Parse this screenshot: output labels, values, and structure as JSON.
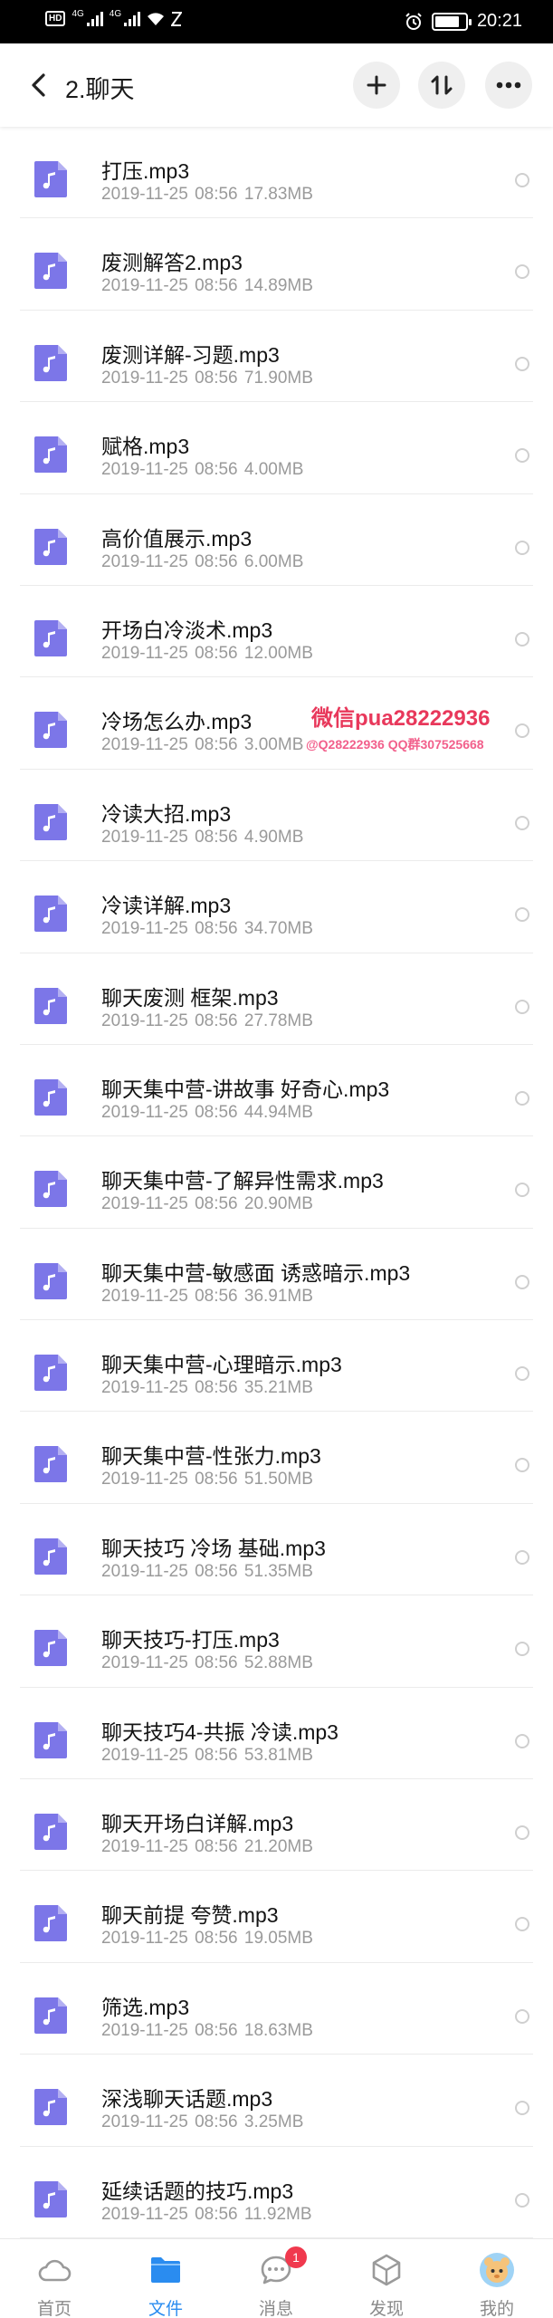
{
  "status_bar": {
    "network_badge": "HD",
    "signal1_label": "4G",
    "signal2_label": "4G",
    "time": "20:21"
  },
  "header": {
    "title": "2.聊天"
  },
  "files": [
    {
      "name": "打压.mp3",
      "date": "2019-11-25",
      "time": "08:56",
      "size": "17.83MB"
    },
    {
      "name": "废测解答2.mp3",
      "date": "2019-11-25",
      "time": "08:56",
      "size": "14.89MB"
    },
    {
      "name": "废测详解-习题.mp3",
      "date": "2019-11-25",
      "time": "08:56",
      "size": "71.90MB"
    },
    {
      "name": "赋格.mp3",
      "date": "2019-11-25",
      "time": "08:56",
      "size": "4.00MB"
    },
    {
      "name": "高价值展示.mp3",
      "date": "2019-11-25",
      "time": "08:56",
      "size": "6.00MB"
    },
    {
      "name": "开场白冷淡术.mp3",
      "date": "2019-11-25",
      "time": "08:56",
      "size": "12.00MB"
    },
    {
      "name": "冷场怎么办.mp3",
      "date": "2019-11-25",
      "time": "08:56",
      "size": "3.00MB"
    },
    {
      "name": "冷读大招.mp3",
      "date": "2019-11-25",
      "time": "08:56",
      "size": "4.90MB"
    },
    {
      "name": "冷读详解.mp3",
      "date": "2019-11-25",
      "time": "08:56",
      "size": "34.70MB"
    },
    {
      "name": "聊天废测  框架.mp3",
      "date": "2019-11-25",
      "time": "08:56",
      "size": "27.78MB"
    },
    {
      "name": "聊天集中营-讲故事 好奇心.mp3",
      "date": "2019-11-25",
      "time": "08:56",
      "size": "44.94MB"
    },
    {
      "name": "聊天集中营-了解异性需求.mp3",
      "date": "2019-11-25",
      "time": "08:56",
      "size": "20.90MB"
    },
    {
      "name": "聊天集中营-敏感面 诱惑暗示.mp3",
      "date": "2019-11-25",
      "time": "08:56",
      "size": "36.91MB"
    },
    {
      "name": "聊天集中营-心理暗示.mp3",
      "date": "2019-11-25",
      "time": "08:56",
      "size": "35.21MB"
    },
    {
      "name": "聊天集中营-性张力.mp3",
      "date": "2019-11-25",
      "time": "08:56",
      "size": "51.50MB"
    },
    {
      "name": "聊天技巧 冷场 基础.mp3",
      "date": "2019-11-25",
      "time": "08:56",
      "size": "51.35MB"
    },
    {
      "name": "聊天技巧-打压.mp3",
      "date": "2019-11-25",
      "time": "08:56",
      "size": "52.88MB"
    },
    {
      "name": "聊天技巧4-共振 冷读.mp3",
      "date": "2019-11-25",
      "time": "08:56",
      "size": "53.81MB"
    },
    {
      "name": "聊天开场白详解.mp3",
      "date": "2019-11-25",
      "time": "08:56",
      "size": "21.20MB"
    },
    {
      "name": "聊天前提 夸赞.mp3",
      "date": "2019-11-25",
      "time": "08:56",
      "size": "19.05MB"
    },
    {
      "name": "筛选.mp3",
      "date": "2019-11-25",
      "time": "08:56",
      "size": "18.63MB"
    },
    {
      "name": "深浅聊天话题.mp3",
      "date": "2019-11-25",
      "time": "08:56",
      "size": "3.25MB"
    },
    {
      "name": "延续话题的技巧.mp3",
      "date": "2019-11-25",
      "time": "08:56",
      "size": "11.92MB"
    }
  ],
  "watermark": {
    "main": "微信pua28222936",
    "sub": "@Q28222936 QQ群307525668"
  },
  "bottom_nav": {
    "tabs": [
      {
        "label": "首页",
        "icon": "cloud-icon"
      },
      {
        "label": "文件",
        "icon": "folder-icon"
      },
      {
        "label": "消息",
        "icon": "chat-bubble-icon",
        "badge": "1"
      },
      {
        "label": "发现",
        "icon": "cube-icon"
      },
      {
        "label": "我的",
        "icon": "avatar-icon"
      }
    ],
    "active_tab": "文件"
  },
  "colors": {
    "accent": "#2a8cf0",
    "file_icon": "#7c76e8",
    "badge": "#f0394e",
    "watermark": "#e8385b"
  }
}
